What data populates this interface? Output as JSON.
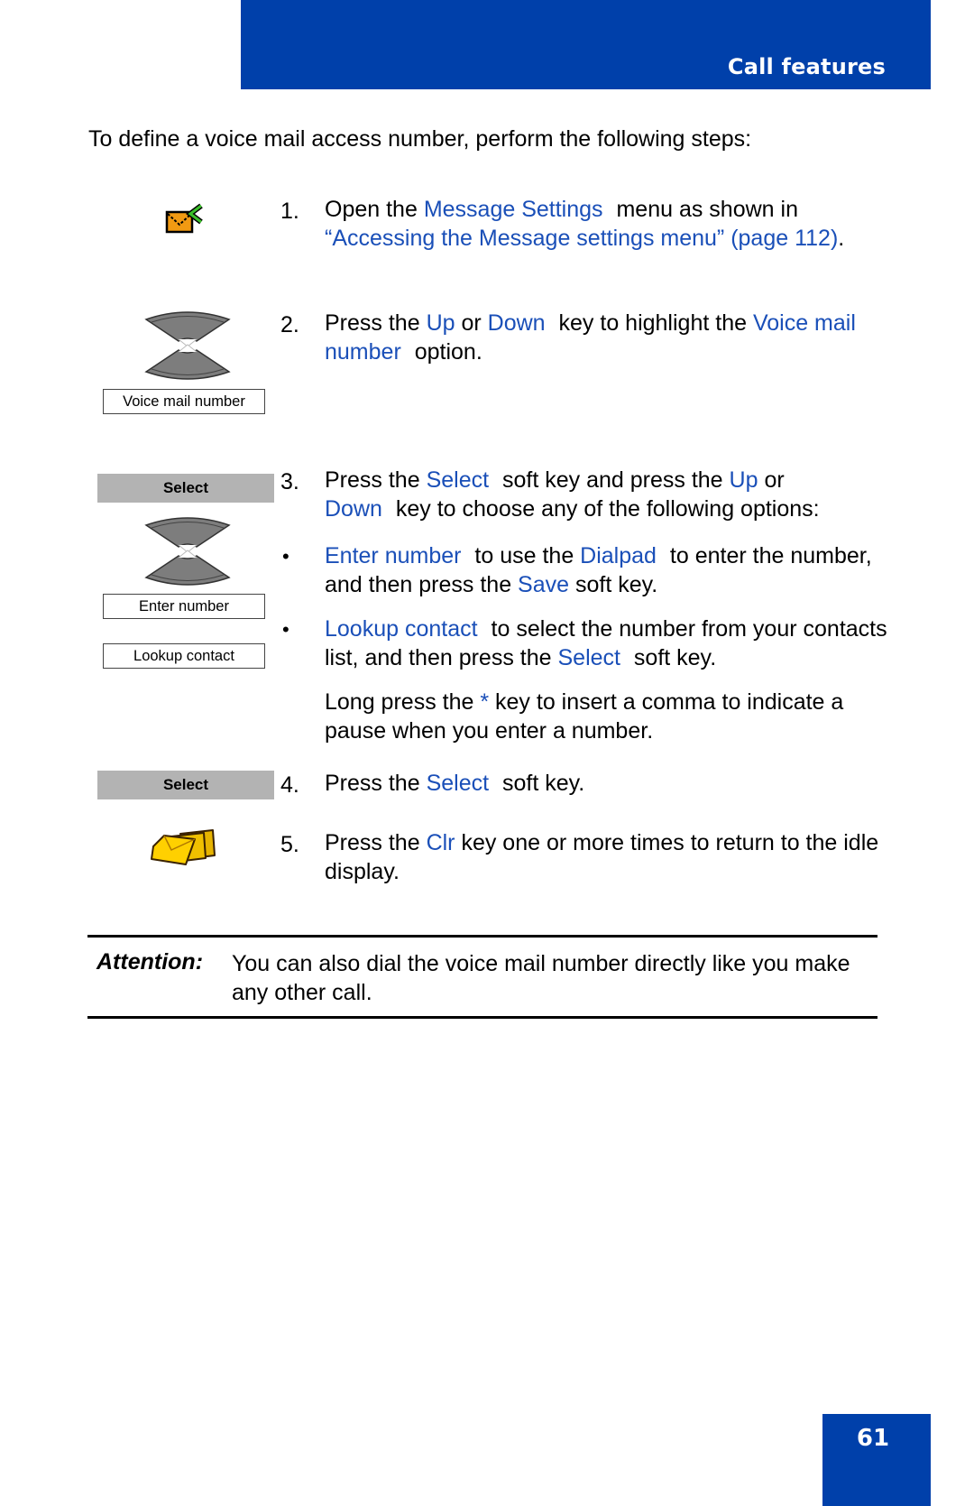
{
  "header": {
    "section_title": "Call features",
    "band_color": "#0040AA"
  },
  "intro": "To define a voice mail access number, perform the following steps:",
  "link_color": "#1a4fb8",
  "steps": [
    {
      "number": "1.",
      "icon": "message-settings-envelope-icon",
      "parts": [
        "Open the ",
        "Message Settings",
        " menu as shown in ",
        "“Accessing the Message settings menu” (page 112)",
        "."
      ]
    },
    {
      "number": "2.",
      "icon": "up-down-navigation-key-icon",
      "display_option": "Voice mail number",
      "parts": [
        "Press the ",
        "Up",
        " or ",
        "Down",
        " key to highlight the ",
        "Voice mail number",
        " option."
      ]
    },
    {
      "number": "3.",
      "softkey": "Select",
      "icon": "up-down-navigation-key-icon",
      "display_options": [
        "Enter number",
        "Lookup contact"
      ],
      "parts": [
        "Press the ",
        "Select",
        " soft key and press the ",
        "Up",
        " or ",
        "Down",
        " key to choose any of the following options:"
      ],
      "bullets": [
        {
          "parts": [
            "Enter number",
            " to use the ",
            "Dialpad",
            " to enter the number, and then press the ",
            "Save",
            " soft key."
          ]
        },
        {
          "parts": [
            "Lookup contact",
            " to select the number from your contacts list, and then press the ",
            "Select",
            " soft key."
          ]
        }
      ],
      "note": [
        "Long press the ",
        "*",
        " key to insert a comma to indicate a pause when you enter a number."
      ]
    },
    {
      "number": "4.",
      "softkey": "Select",
      "parts": [
        "Press the ",
        "Select",
        " soft key."
      ]
    },
    {
      "number": "5.",
      "icon": "clr-key-envelopes-icon",
      "parts": [
        "Press the ",
        "Clr",
        " key one or more times to return to the idle display."
      ]
    }
  ],
  "attention": {
    "label": "Attention:",
    "text": "You can also dial the voice mail number directly like you make any other call."
  },
  "footer": {
    "page_number": "61"
  }
}
